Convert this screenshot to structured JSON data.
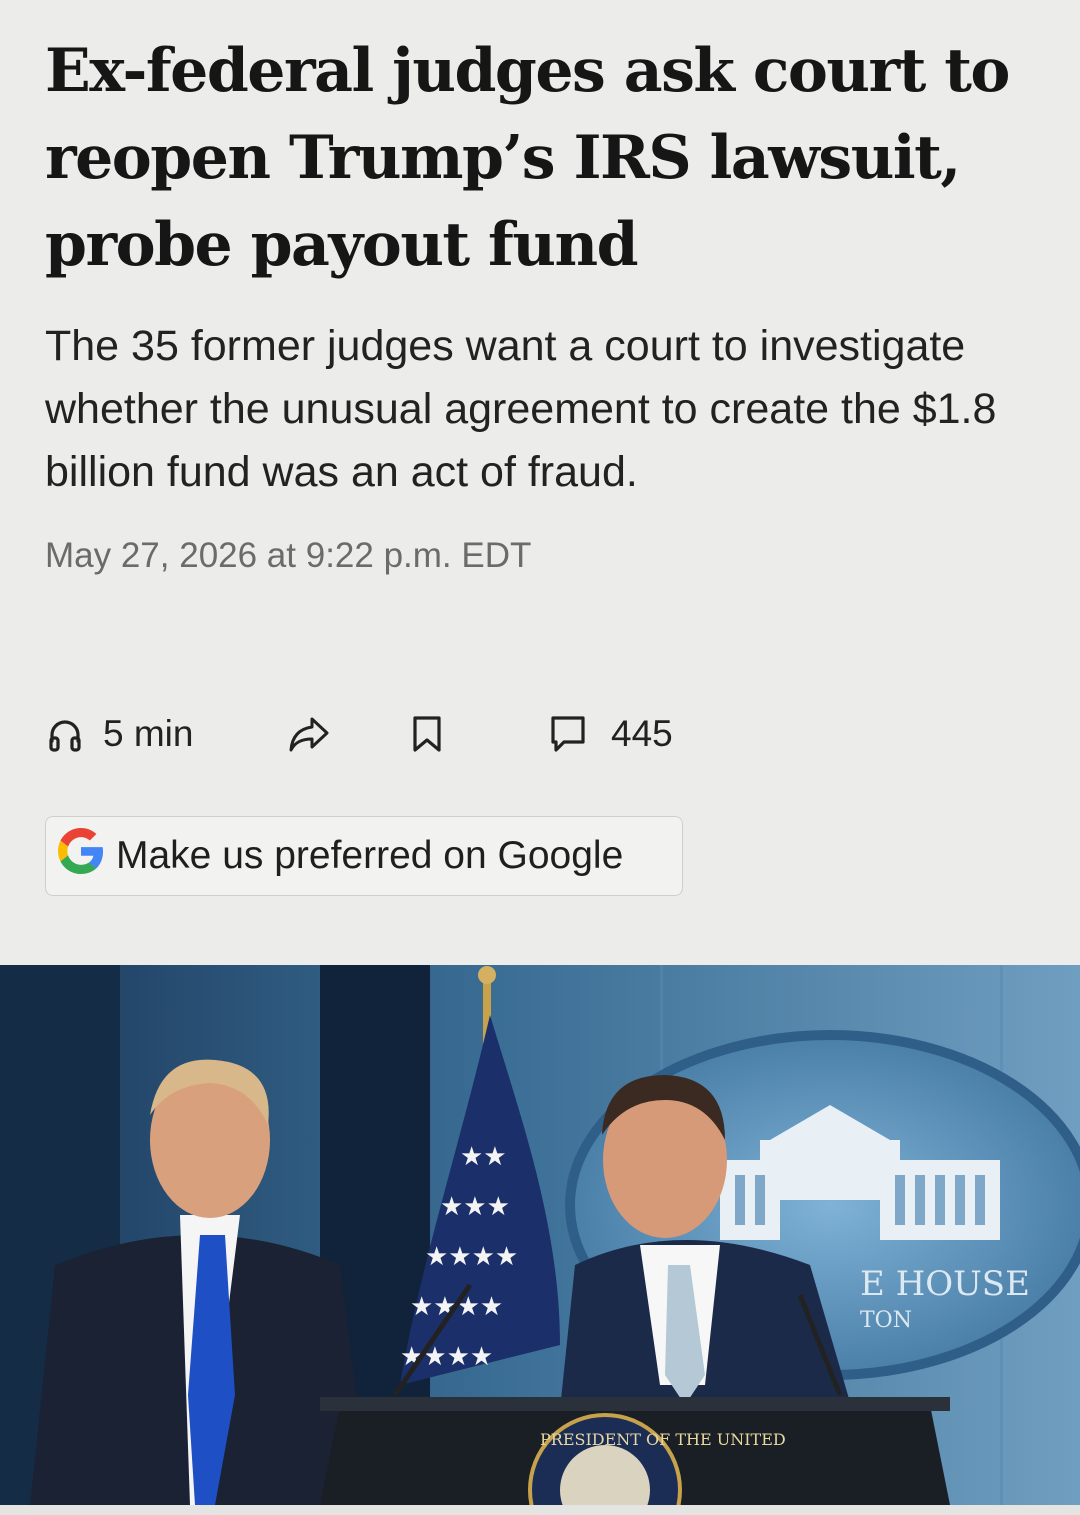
{
  "article": {
    "headline": "Ex-federal judges ask court to reopen Trump’s IRS lawsuit, probe payout fund",
    "dek": "The 35 former judges want a court to investigate whether the unusual agreement to create the $1.8 billion fund was an act of fraud.",
    "timestamp": "May 27, 2026 at 9:22 p.m. EDT"
  },
  "toolbar": {
    "listen_label": "5 min",
    "listen_icon": "headphones-icon",
    "share_icon": "share-arrow-icon",
    "save_icon": "bookmark-icon",
    "comments_icon": "comment-bubble-icon",
    "comments_count": "445"
  },
  "google_button": {
    "label": "Make us preferred on Google",
    "icon": "google-g-icon"
  },
  "photo": {
    "seal_text": "PRESIDENT OF THE UNITED",
    "backdrop_text_1": "E HOUSE",
    "backdrop_text_2": "TON"
  },
  "colors": {
    "background": "#ececea",
    "headline": "#161616",
    "timestamp": "#6b6b6b",
    "google_blue": "#4285F4",
    "google_red": "#EA4335",
    "google_yellow": "#FBBC05",
    "google_green": "#34A853"
  }
}
